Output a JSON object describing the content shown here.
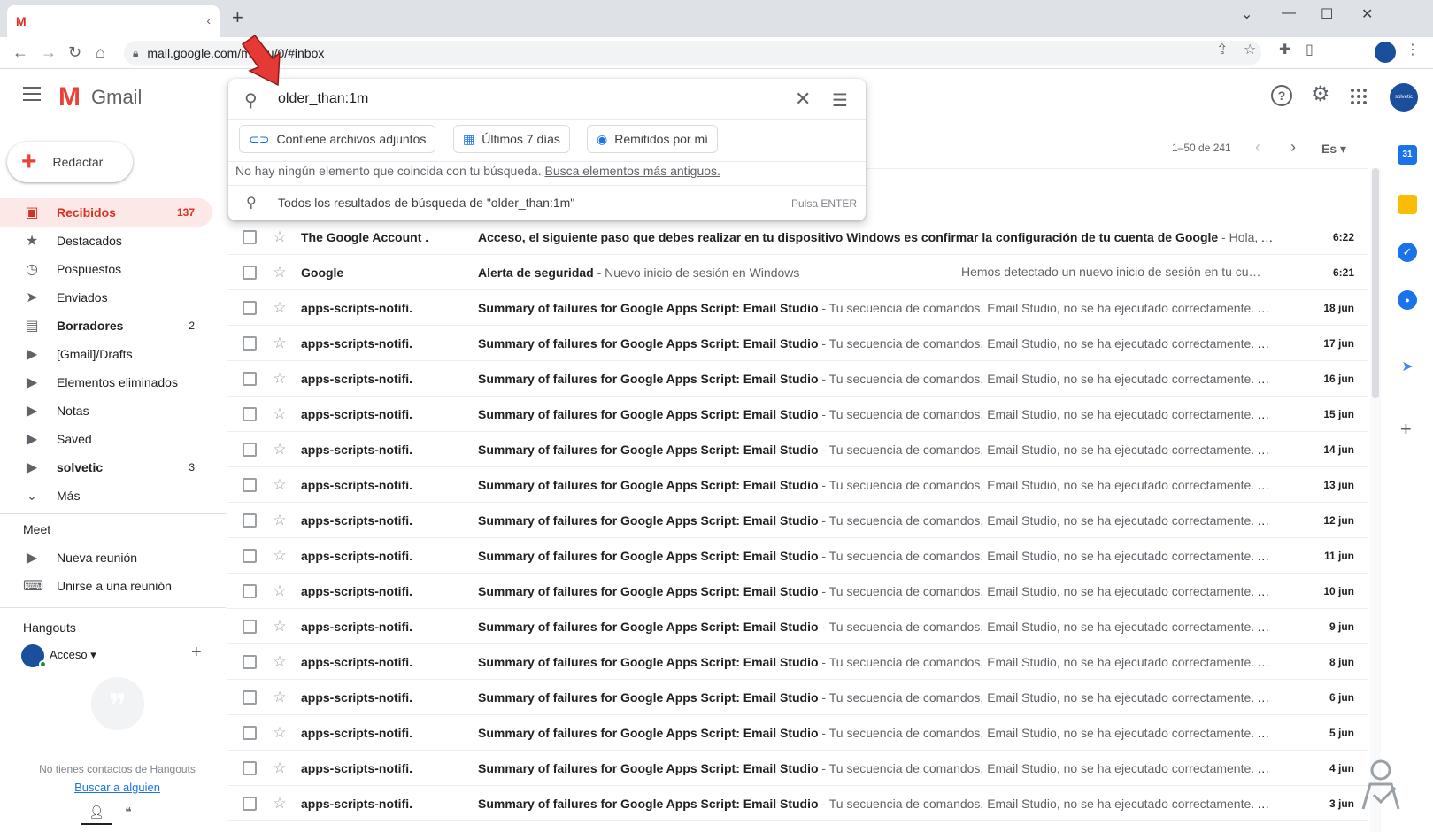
{
  "browser": {
    "tab_favicon": "M",
    "tab_close": "‹",
    "new_tab": "+",
    "url": "mail.google.com/mail/u/0/#inbox",
    "window_controls": [
      "⌄",
      "—",
      "☐",
      "✕"
    ]
  },
  "gmail": {
    "product_name": "Gmail",
    "logo_letter": "M",
    "avatar_text": "solvetic",
    "brand_red": "#d93025",
    "accent_blue": "#1a73e8"
  },
  "search": {
    "query": "older_than:1m",
    "chips": [
      {
        "label": "Contiene archivos adjuntos",
        "icon": "attachment-icon"
      },
      {
        "label": "Últimos 7 días",
        "icon": "calendar-icon"
      },
      {
        "label": "Remitidos por mí",
        "icon": "person-icon"
      }
    ],
    "no_results": "No hay ningún elemento que coincida con tu búsqueda.",
    "older_link": "Busca elementos más antiguos.",
    "all_results": "Todos los resultados de búsqueda de \"older_than:1m\"",
    "enter_hint": "Pulsa ENTER"
  },
  "sidebar": {
    "compose": "Redactar",
    "items": [
      {
        "label": "Recibidos",
        "count": "137",
        "icon": "inbox-icon",
        "active": true
      },
      {
        "label": "Destacados",
        "count": "",
        "icon": "star-icon"
      },
      {
        "label": "Pospuestos",
        "count": "",
        "icon": "clock-icon"
      },
      {
        "label": "Enviados",
        "count": "",
        "icon": "send-icon"
      },
      {
        "label": "Borradores",
        "count": "2",
        "icon": "draft-icon",
        "bold": true
      },
      {
        "label": "[Gmail]/Drafts",
        "count": "",
        "icon": "label-icon"
      },
      {
        "label": "Elementos eliminados",
        "count": "",
        "icon": "label-icon"
      },
      {
        "label": "Notas",
        "count": "",
        "icon": "label-icon"
      },
      {
        "label": "Saved",
        "count": "",
        "icon": "label-icon"
      },
      {
        "label": "solvetic",
        "count": "3",
        "icon": "label-icon",
        "bold": true
      },
      {
        "label": "Más",
        "count": "",
        "icon": "chevron-down-icon"
      }
    ],
    "meet_title": "Meet",
    "meet_items": [
      {
        "label": "Nueva reunión",
        "icon": "video-icon"
      },
      {
        "label": "Unirse a una reunión",
        "icon": "keyboard-icon"
      }
    ],
    "hangouts_title": "Hangouts",
    "hangouts_user": "Acceso",
    "hangouts_empty": "No tienes contactos de Hangouts",
    "hangouts_link": "Buscar a alguien"
  },
  "pager": {
    "range": "1–50 de 241",
    "lang": "Es"
  },
  "emails": [
    {
      "sender": "The Google Account .",
      "subject": "Acceso, el siguiente paso que debes realizar en tu dispositivo Windows es confirmar la configuración de tu cuenta de Google",
      "snippet": " - Hola, Acce…",
      "date": "6:22",
      "snippet_right": ""
    },
    {
      "sender": "Google",
      "subject": "Alerta de seguridad",
      "snippet": " - Nuevo inicio de sesión en Windows",
      "date": "6:21",
      "snippet_right": "Hemos detectado un nuevo inicio de sesión en tu cu…"
    },
    {
      "sender": "apps-scripts-notifi.",
      "subject": "Summary of failures for Google Apps Script: Email Studio",
      "snippet": " - Tu secuencia de comandos, Email Studio, no se ha ejecutado correctamente. A …",
      "date": "18 jun",
      "snippet_right": ""
    },
    {
      "sender": "apps-scripts-notifi.",
      "subject": "Summary of failures for Google Apps Script: Email Studio",
      "snippet": " - Tu secuencia de comandos, Email Studio, no se ha ejecutado correctamente. A …",
      "date": "17 jun",
      "snippet_right": ""
    },
    {
      "sender": "apps-scripts-notifi.",
      "subject": "Summary of failures for Google Apps Script: Email Studio",
      "snippet": " - Tu secuencia de comandos, Email Studio, no se ha ejecutado correctamente. A …",
      "date": "16 jun",
      "snippet_right": ""
    },
    {
      "sender": "apps-scripts-notifi.",
      "subject": "Summary of failures for Google Apps Script: Email Studio",
      "snippet": " - Tu secuencia de comandos, Email Studio, no se ha ejecutado correctamente. A …",
      "date": "15 jun",
      "snippet_right": ""
    },
    {
      "sender": "apps-scripts-notifi.",
      "subject": "Summary of failures for Google Apps Script: Email Studio",
      "snippet": " - Tu secuencia de comandos, Email Studio, no se ha ejecutado correctamente. A …",
      "date": "14 jun",
      "snippet_right": ""
    },
    {
      "sender": "apps-scripts-notifi.",
      "subject": "Summary of failures for Google Apps Script: Email Studio",
      "snippet": " - Tu secuencia de comandos, Email Studio, no se ha ejecutado correctamente. A …",
      "date": "13 jun",
      "snippet_right": ""
    },
    {
      "sender": "apps-scripts-notifi.",
      "subject": "Summary of failures for Google Apps Script: Email Studio",
      "snippet": " - Tu secuencia de comandos, Email Studio, no se ha ejecutado correctamente. A …",
      "date": "12 jun",
      "snippet_right": ""
    },
    {
      "sender": "apps-scripts-notifi.",
      "subject": "Summary of failures for Google Apps Script: Email Studio",
      "snippet": " - Tu secuencia de comandos, Email Studio, no se ha ejecutado correctamente. A …",
      "date": "11 jun",
      "snippet_right": ""
    },
    {
      "sender": "apps-scripts-notifi.",
      "subject": "Summary of failures for Google Apps Script: Email Studio",
      "snippet": " - Tu secuencia de comandos, Email Studio, no se ha ejecutado correctamente. A …",
      "date": "10 jun",
      "snippet_right": ""
    },
    {
      "sender": "apps-scripts-notifi.",
      "subject": "Summary of failures for Google Apps Script: Email Studio",
      "snippet": " - Tu secuencia de comandos, Email Studio, no se ha ejecutado correctamente. A …",
      "date": "9 jun",
      "snippet_right": ""
    },
    {
      "sender": "apps-scripts-notifi.",
      "subject": "Summary of failures for Google Apps Script: Email Studio",
      "snippet": " - Tu secuencia de comandos, Email Studio, no se ha ejecutado correctamente. A …",
      "date": "8 jun",
      "snippet_right": ""
    },
    {
      "sender": "apps-scripts-notifi.",
      "subject": "Summary of failures for Google Apps Script: Email Studio",
      "snippet": " - Tu secuencia de comandos, Email Studio, no se ha ejecutado correctamente. A …",
      "date": "6 jun",
      "snippet_right": ""
    },
    {
      "sender": "apps-scripts-notifi.",
      "subject": "Summary of failures for Google Apps Script: Email Studio",
      "snippet": " - Tu secuencia de comandos, Email Studio, no se ha ejecutado correctamente. A …",
      "date": "5 jun",
      "snippet_right": ""
    },
    {
      "sender": "apps-scripts-notifi.",
      "subject": "Summary of failures for Google Apps Script: Email Studio",
      "snippet": " - Tu secuencia de comandos, Email Studio, no se ha ejecutado correctamente. A …",
      "date": "4 jun",
      "snippet_right": ""
    },
    {
      "sender": "apps-scripts-notifi.",
      "subject": "Summary of failures for Google Apps Script: Email Studio",
      "snippet": " - Tu secuencia de comandos, Email Studio, no se ha ejecutado correctamente. A …",
      "date": "3 jun",
      "snippet_right": ""
    }
  ],
  "side_panel": [
    {
      "icon": "calendar-icon",
      "text": "31",
      "color": "#1a73e8"
    },
    {
      "icon": "keep-icon",
      "text": "",
      "color": "#fbbc04"
    },
    {
      "icon": "tasks-icon",
      "text": "✓",
      "color": "#1a73e8"
    },
    {
      "icon": "contacts-icon",
      "text": "●",
      "color": "#1a73e8"
    },
    {
      "icon": "send-addon-icon",
      "text": "➤",
      "color": "#4285f4"
    }
  ]
}
